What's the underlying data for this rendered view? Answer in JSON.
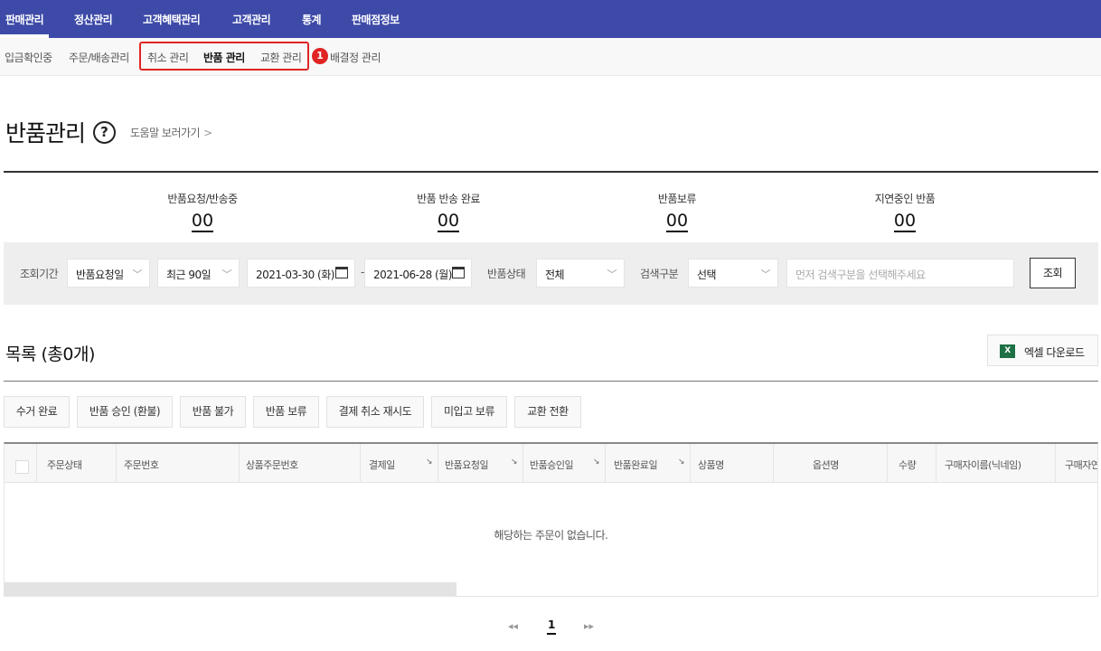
{
  "topnav": {
    "items": [
      "판매관리",
      "정산관리",
      "고객혜택관리",
      "고객관리",
      "통계",
      "판매점정보"
    ]
  },
  "subnav": {
    "items": [
      "입금확인중",
      "주문/배송관리",
      "취소 관리",
      "반품 관리",
      "교환 관리",
      "배결정 관리"
    ],
    "badge": "1"
  },
  "page": {
    "title": "반품관리",
    "help_icon": "?",
    "help_link": "도움말 보러가기",
    "help_chevron": ">"
  },
  "summary": [
    {
      "label": "반품요청/반송중",
      "value": "00"
    },
    {
      "label": "반품 반송 완료",
      "value": "00"
    },
    {
      "label": "반품보류",
      "value": "00"
    },
    {
      "label": "지연중인 반품",
      "value": "00"
    }
  ],
  "filter": {
    "period_label": "조회기간",
    "date_type": "반품요청일",
    "range": "최근 90일",
    "start_date": "2021-03-30 (화)",
    "dash": "-",
    "end_date": "2021-06-28 (월)",
    "status_label": "반품상태",
    "status": "전체",
    "search_type_label": "검색구분",
    "search_type": "선택",
    "search_placeholder": "먼저 검색구분을 선택해주세요",
    "search_button": "조회",
    "dropdown_icon": "﹀"
  },
  "list": {
    "title": "목록 (총0개)",
    "excel_icon": "X",
    "excel_button": "엑셀 다운로드"
  },
  "actions": [
    "수거 완료",
    "반품 승인 (환불)",
    "반품 불가",
    "반품 보류",
    "결제 취소 재시도",
    "미입고 보류",
    "교환 전환"
  ],
  "table": {
    "columns": [
      "주문상태",
      "주문번호",
      "상품주문번호",
      "결제일",
      "반품요청일",
      "반품승인일",
      "반품완료일",
      "상품명",
      "옵션명",
      "수량",
      "구매자이름(닉네임)",
      "구매자연"
    ],
    "sort_mark": "↘",
    "empty_message": "해당하는 주문이 없습니다."
  },
  "pagination": {
    "prev": "◂◂",
    "current": "1",
    "next": "▸▸"
  },
  "colors": {
    "nav_bg": "#3d4aa8",
    "highlight": "#e02424",
    "excel_green": "#1e7145"
  }
}
